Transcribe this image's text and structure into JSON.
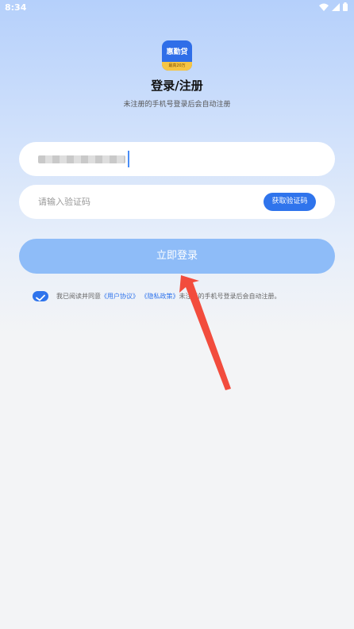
{
  "status_bar": {
    "time": "8:34"
  },
  "app": {
    "logo_name": "惠勤贷",
    "logo_strip": "最高20万"
  },
  "header": {
    "title": "登录/注册",
    "subtitle": "未注册的手机号登录后会自动注册"
  },
  "form": {
    "code_placeholder": "请输入验证码",
    "get_code_label": "获取验证码",
    "login_label": "立即登录"
  },
  "agreement": {
    "prefix": "我已阅读并同意",
    "user_agreement": "《用户协议》",
    "privacy_policy": "《隐私政策》",
    "suffix": "未注册的手机号登录后会自动注册。"
  },
  "colors": {
    "accent": "#2f74ec",
    "login_button": "#8ebcf8",
    "annotation_arrow": "#f24c3d"
  },
  "icons": [
    "wifi-icon",
    "signal-icon",
    "battery-icon",
    "checkbox-checked-icon",
    "annotation-arrow-icon"
  ]
}
